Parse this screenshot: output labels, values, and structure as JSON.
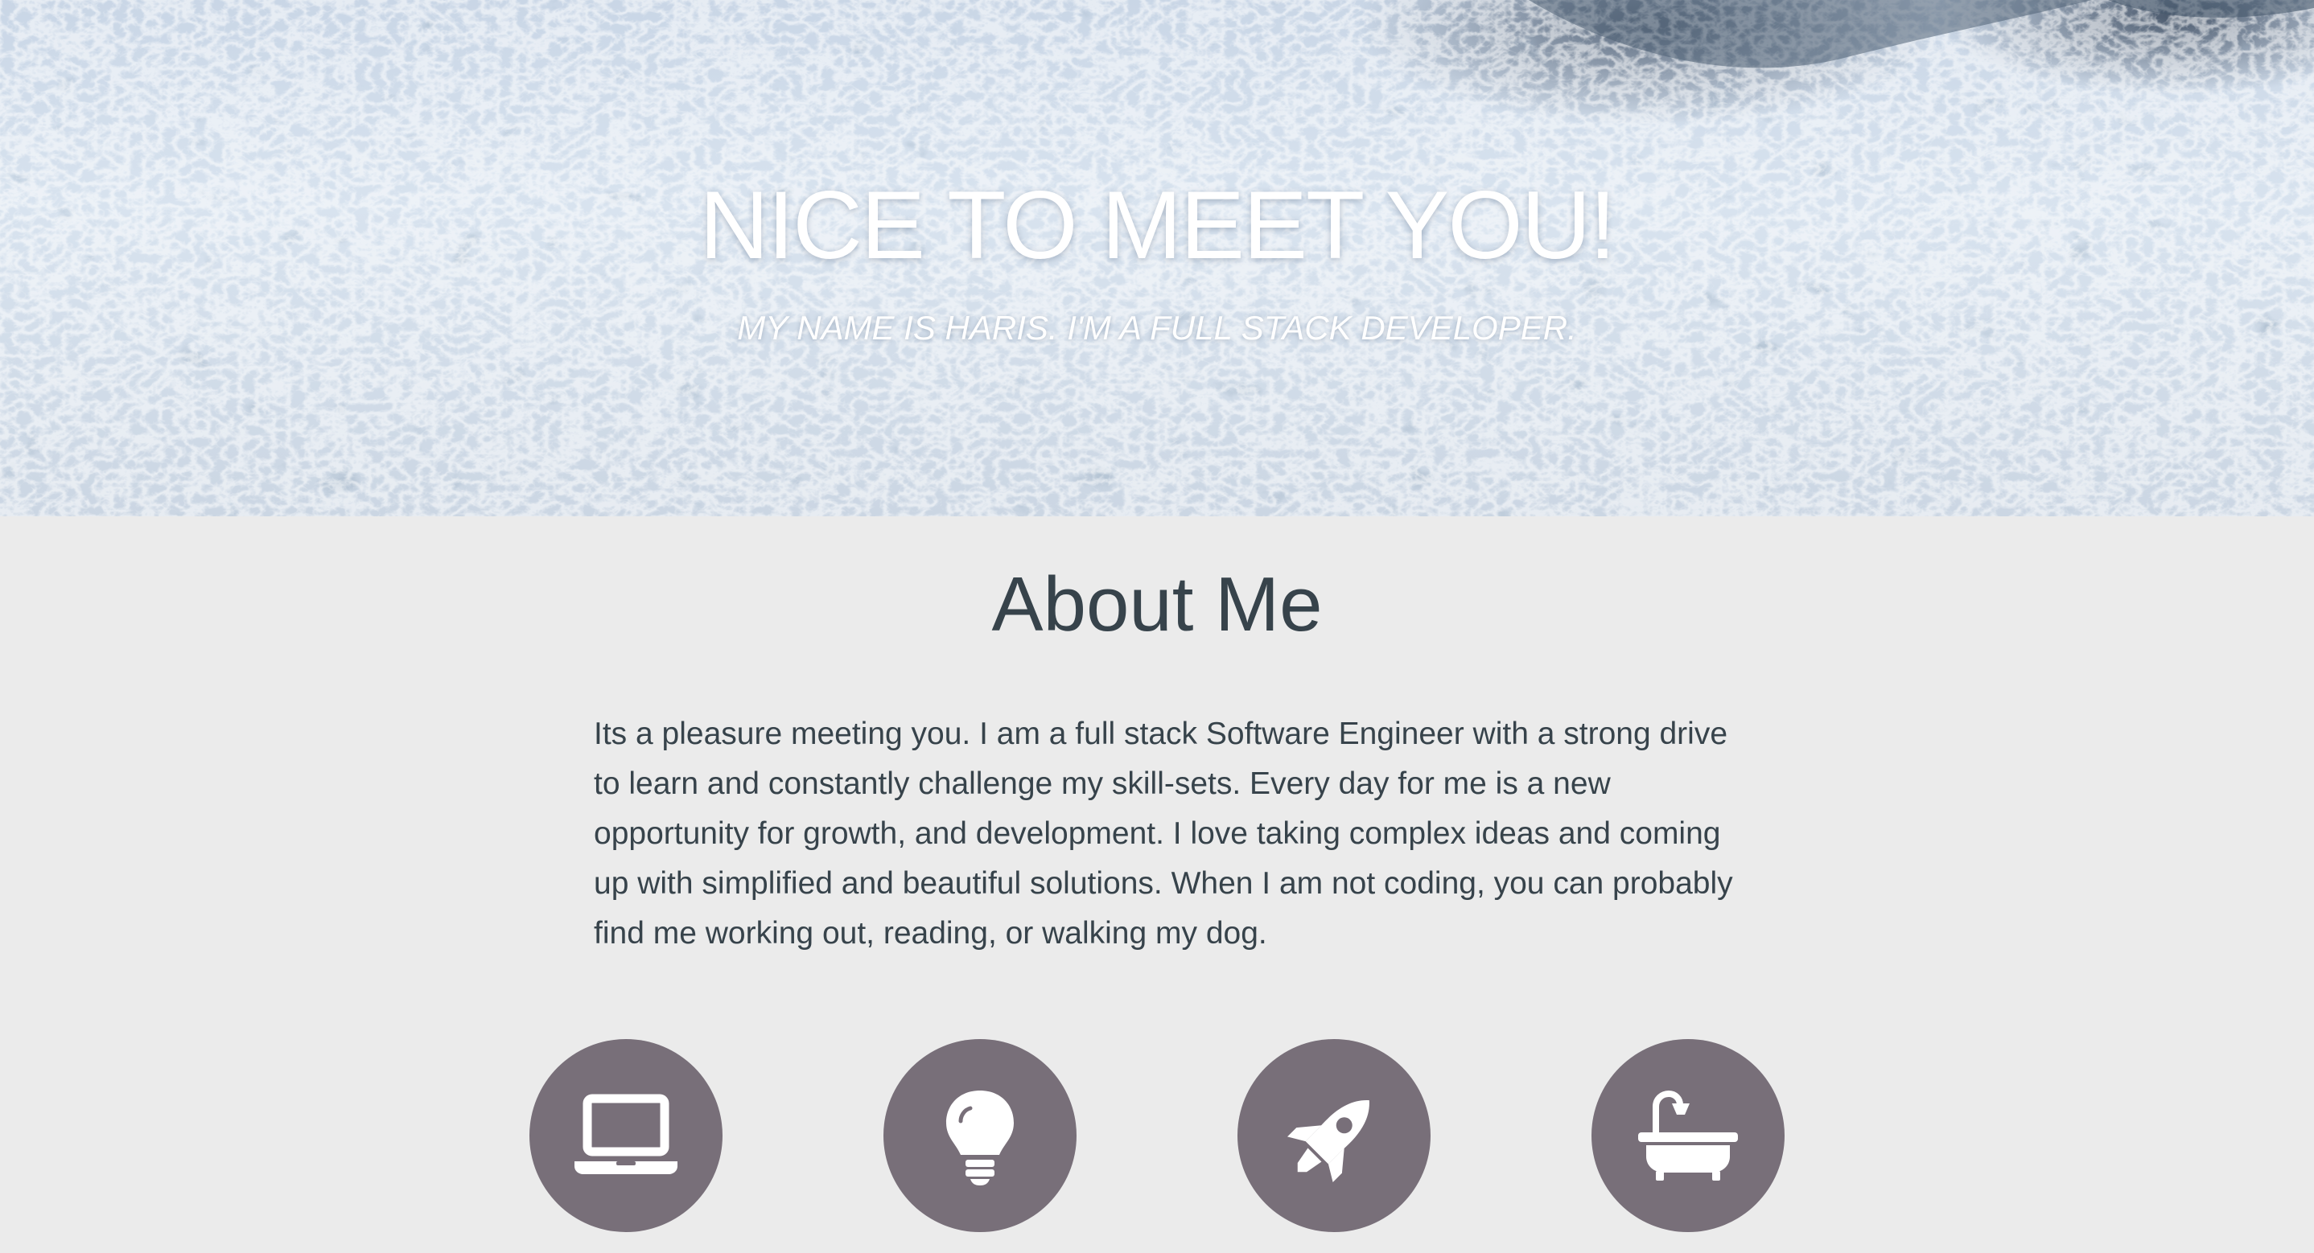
{
  "hero": {
    "title": "NICE TO MEET YOU!",
    "subtitle": "MY NAME IS HARIS. I'M A FULL STACK DEVELOPER."
  },
  "about": {
    "title": "About Me",
    "body": "Its a pleasure meeting you. I am a full stack Software Engineer with a strong drive to learn and constantly challenge my skill-sets. Every day for me is a new opportunity for growth, and development. I love taking complex ideas and coming up with simplified and beautiful solutions. When I am not coding, you can probably find me working out, reading, or walking my dog."
  },
  "features": [
    {
      "icon": "laptop-icon"
    },
    {
      "icon": "lightbulb-icon"
    },
    {
      "icon": "rocket-icon"
    },
    {
      "icon": "bathtub-icon"
    }
  ],
  "colors": {
    "background": "#ebebeb",
    "text": "#37434b",
    "icon_circle": "#786f79",
    "icon_glyph": "#ffffff"
  }
}
